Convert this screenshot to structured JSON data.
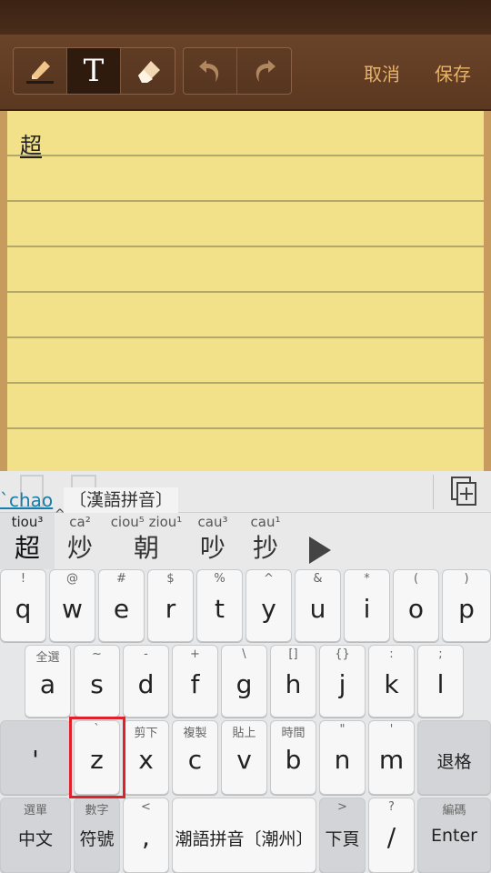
{
  "toolbar": {
    "tools": [
      {
        "icon": "highlighter-pen-icon",
        "active": false
      },
      {
        "icon": "text-tool-icon",
        "label": "T",
        "active": true
      },
      {
        "icon": "eraser-icon",
        "active": false
      }
    ],
    "history": [
      {
        "icon": "undo-icon"
      },
      {
        "icon": "redo-icon"
      }
    ],
    "cancel_label": "取消",
    "save_label": "保存"
  },
  "note": {
    "text": "超"
  },
  "ime": {
    "composing": "`chao",
    "caret": "^",
    "mode_label": "〔漢語拼音〕",
    "paste_icon": "paste-icon"
  },
  "candidates": [
    {
      "rom": "tiou³",
      "char": "超"
    },
    {
      "rom": "ca²",
      "char": "炒"
    },
    {
      "rom": "ciou⁵ ziou¹",
      "char": "朝"
    },
    {
      "rom": "cau³",
      "char": "吵"
    },
    {
      "rom": "cau¹",
      "char": "抄"
    }
  ],
  "more_icon": "play-arrow-icon",
  "keys": {
    "row1": [
      {
        "hint": "!",
        "key": "q"
      },
      {
        "hint": "@",
        "key": "w"
      },
      {
        "hint": "#",
        "key": "e"
      },
      {
        "hint": "$",
        "key": "r"
      },
      {
        "hint": "%",
        "key": "t"
      },
      {
        "hint": "^",
        "key": "y"
      },
      {
        "hint": "&",
        "key": "u"
      },
      {
        "hint": "*",
        "key": "i"
      },
      {
        "hint": "(",
        "key": "o"
      },
      {
        "hint": ")",
        "key": "p"
      }
    ],
    "row2": [
      {
        "hint": "全選",
        "key": "a"
      },
      {
        "hint": "~",
        "key": "s"
      },
      {
        "hint": "-",
        "key": "d"
      },
      {
        "hint": "+",
        "key": "f"
      },
      {
        "hint": "\\",
        "key": "g"
      },
      {
        "hint": "[]",
        "key": "h"
      },
      {
        "hint": "{}",
        "key": "j"
      },
      {
        "hint": ":",
        "key": "k"
      },
      {
        "hint": ";",
        "key": "l"
      }
    ],
    "row3": [
      {
        "hint": "",
        "key": "'"
      },
      {
        "hint": "`",
        "key": "z"
      },
      {
        "hint": "剪下",
        "key": "x"
      },
      {
        "hint": "複製",
        "key": "c"
      },
      {
        "hint": "貼上",
        "key": "v"
      },
      {
        "hint": "時間",
        "key": "b"
      },
      {
        "hint": "\"",
        "key": "n"
      },
      {
        "hint": "'",
        "key": "m"
      },
      {
        "hint": "",
        "key": "退格"
      }
    ],
    "row4": [
      {
        "hint": "選單",
        "key": "中文"
      },
      {
        "hint": "數字",
        "key": "符號"
      },
      {
        "hint": "<",
        "key": ","
      },
      {
        "hint": "",
        "key": "潮語拼音〔潮州〕"
      },
      {
        "hint": ">",
        "key": "下頁"
      },
      {
        "hint": "?",
        "key": "/"
      },
      {
        "hint": "編碼",
        "key": "Enter"
      }
    ]
  },
  "colors": {
    "toolbar": "#5b3820",
    "toolbar_text": "#e7b36b",
    "paper": "#f2e188",
    "composing_text": "#1a7ca8",
    "highlight_box": "#e0202a"
  }
}
